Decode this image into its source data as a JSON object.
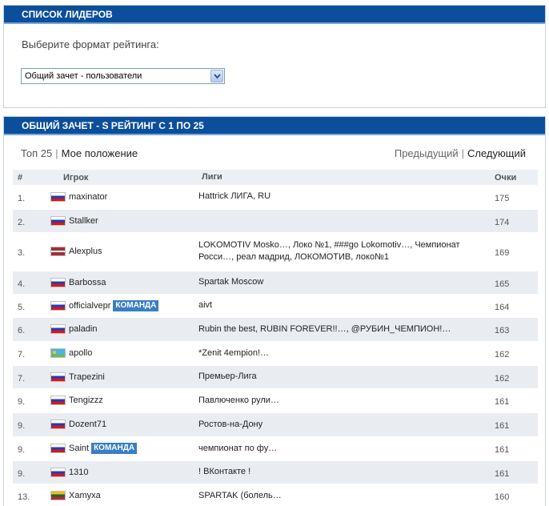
{
  "panel1": {
    "title": "СПИСОК ЛИДЕРОВ",
    "format_label": "Выберите формат рейтинга:",
    "select_value": "Общий зачет - пользователи"
  },
  "panel2": {
    "title": "ОБЩИЙ ЗАЧЕТ - S РЕЙТИНГ С 1 ПО 25",
    "nav_top25": "Топ 25",
    "nav_my_position": "Мое положение",
    "nav_prev": "Предыдущий",
    "nav_next": "Следующий",
    "columns": {
      "num": "#",
      "player": "Игрок",
      "leagues": "Лиги",
      "points": "Очки"
    },
    "team_badge": "КОМАНДА",
    "rows": [
      {
        "rank": "1.",
        "flag": "ru",
        "player": "maxinator",
        "team": false,
        "leagues": "Hattrick ЛИГА, RU",
        "points": "175"
      },
      {
        "rank": "2.",
        "flag": "ru",
        "player": "Stallker",
        "team": false,
        "leagues": "",
        "points": "174"
      },
      {
        "rank": "3.",
        "flag": "lv",
        "player": "Alexplus",
        "team": false,
        "leagues": "LOKOMOTIV Mosko…, Локо №1, ###go Lokomotiv…, Чемпионат Росси…, реал мадрид, ЛОКОМОТИВ, локо№1",
        "points": "169"
      },
      {
        "rank": "4.",
        "flag": "ru",
        "player": "Barbossa",
        "team": false,
        "leagues": "Spartak Moscow",
        "points": "165"
      },
      {
        "rank": "5.",
        "flag": "ru",
        "player": "officialvepr",
        "team": true,
        "leagues": "aivt",
        "points": "164"
      },
      {
        "rank": "6.",
        "flag": "ru",
        "player": "paladin",
        "team": false,
        "leagues": "Rubin the best, RUBIN FOREVER!!…, @РУБИН_ЧЕМПИОН!…",
        "points": "163"
      },
      {
        "rank": "7.",
        "flag": "mk",
        "player": "apollo",
        "team": false,
        "leagues": "*Zenit 4empion!…",
        "points": "162"
      },
      {
        "rank": "7.",
        "flag": "ru",
        "player": "Trapezini",
        "team": false,
        "leagues": "Премьер-Лига",
        "points": "162"
      },
      {
        "rank": "9.",
        "flag": "ru",
        "player": "Tengizzz",
        "team": false,
        "leagues": "Павлюченко рули…",
        "points": "161"
      },
      {
        "rank": "9.",
        "flag": "ru",
        "player": "Dozent71",
        "team": false,
        "leagues": "Ростов-на-Дону",
        "points": "161"
      },
      {
        "rank": "9.",
        "flag": "ru",
        "player": "Saint",
        "team": true,
        "leagues": "чемпионат по фу…",
        "points": "161"
      },
      {
        "rank": "9.",
        "flag": "ru",
        "player": "1310",
        "team": false,
        "leagues": "! ВКонтакте !",
        "points": "161"
      },
      {
        "rank": "13.",
        "flag": "lt",
        "player": "Xamyxa",
        "team": false,
        "leagues": "SPARTAK (болель…",
        "points": "160"
      }
    ]
  }
}
